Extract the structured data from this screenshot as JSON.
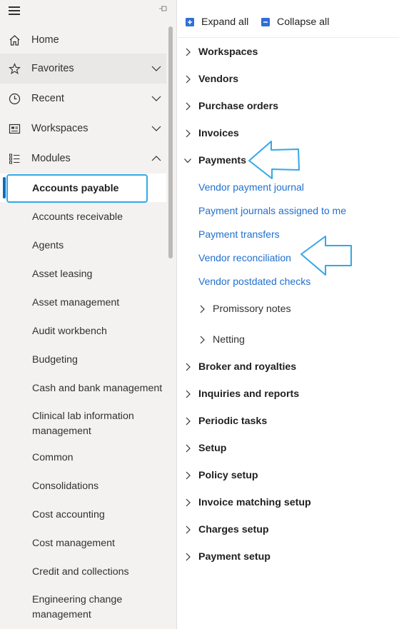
{
  "nav": {
    "top": [
      {
        "label": "Home",
        "icon": "home-icon"
      },
      {
        "label": "Favorites",
        "icon": "star-icon",
        "chevron": "down"
      },
      {
        "label": "Recent",
        "icon": "clock-icon",
        "chevron": "down"
      },
      {
        "label": "Workspaces",
        "icon": "workspace-icon",
        "chevron": "down"
      },
      {
        "label": "Modules",
        "icon": "modules-list-icon",
        "chevron": "up"
      }
    ],
    "modules": [
      "Accounts payable",
      "Accounts receivable",
      "Agents",
      "Asset leasing",
      "Asset management",
      "Audit workbench",
      "Budgeting",
      "Cash and bank management",
      "Clinical lab information management",
      "Common",
      "Consolidations",
      "Cost accounting",
      "Cost management",
      "Credit and collections",
      "Engineering change management"
    ],
    "selected_module": "Accounts payable"
  },
  "toolbar": {
    "expand_label": "Expand all",
    "collapse_label": "Collapse all"
  },
  "content": {
    "groups_before": [
      "Workspaces",
      "Vendors",
      "Purchase orders",
      "Invoices"
    ],
    "expanded_group": "Payments",
    "payment_links": [
      "Vendor payment journal",
      "Payment journals assigned to me",
      "Payment transfers",
      "Vendor reconciliation",
      "Vendor postdated checks"
    ],
    "payment_subgroups": [
      "Promissory notes",
      "Netting"
    ],
    "groups_after": [
      "Broker and royalties",
      "Inquiries and reports",
      "Periodic tasks",
      "Setup",
      "Policy setup",
      "Invoice matching setup",
      "Charges setup",
      "Payment setup"
    ]
  },
  "colors": {
    "link": "#1f6fce",
    "selection_bar": "#0f6cbd",
    "annotation": "#33a8e6",
    "nav_background": "#f3f2f1"
  }
}
